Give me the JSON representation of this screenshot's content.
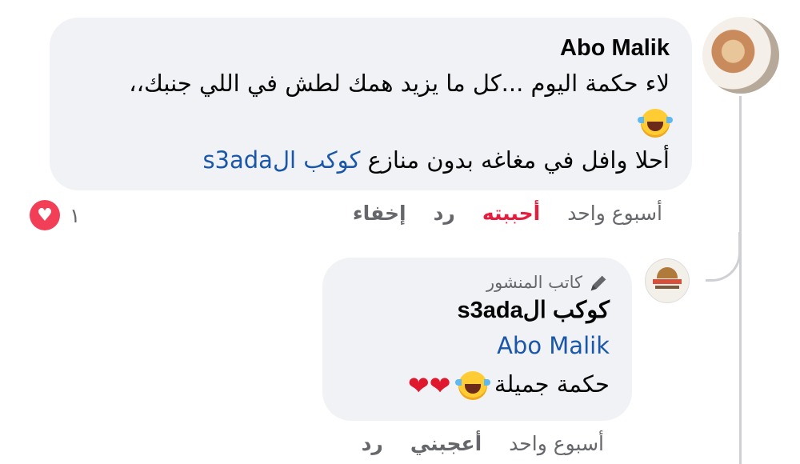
{
  "comment": {
    "author": "Abo Malik",
    "line1": "لاء حكمة اليوم ...كل ما يزيد همك لطش في اللي جنبك،،",
    "line3_text": "أحلا وافل في مغاغه بدون منازع ",
    "mention": "كوكب الs3ada",
    "emoji_icon": "face-with-tears-of-joy",
    "actions": {
      "time": "أسبوع واحد",
      "like": "أحببته",
      "reply": "رد",
      "hide": "إخفاء"
    },
    "reaction_count": "١",
    "reaction_color": "#f33e58"
  },
  "reply": {
    "badge": "كاتب المنشور",
    "author": "كوكب الs3ada",
    "mention": "Abo Malik",
    "text": "حكمة جميلة",
    "hearts": [
      "❤",
      "❤"
    ],
    "actions": {
      "time": "أسبوع واحد",
      "like": "أعجبني",
      "reply": "رد"
    }
  },
  "colors": {
    "bubble": "#f0f2f5",
    "mention": "#1a57a8",
    "liked": "#e41e3f",
    "meta": "#65676b"
  }
}
